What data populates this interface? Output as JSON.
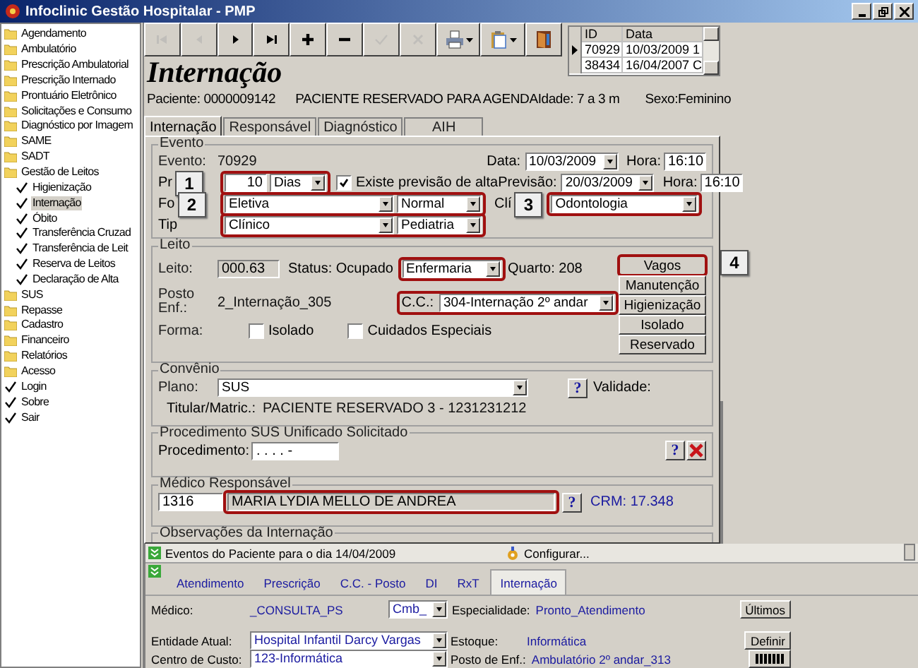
{
  "window": {
    "title": "Infoclinic Gestão Hospitalar - PMP"
  },
  "sidebar": {
    "items": [
      {
        "label": "Agendamento",
        "kind": "folder",
        "selected": false
      },
      {
        "label": "Ambulatório",
        "kind": "folder",
        "selected": false
      },
      {
        "label": "Prescrição Ambulatorial",
        "kind": "folder",
        "selected": false
      },
      {
        "label": "Prescrição Internado",
        "kind": "folder",
        "selected": false
      },
      {
        "label": "Prontuário Eletrônico",
        "kind": "folder",
        "selected": false
      },
      {
        "label": "Solicitações e Consumo",
        "kind": "folder",
        "selected": false
      },
      {
        "label": "Diagnóstico por Imagem",
        "kind": "folder",
        "selected": false
      },
      {
        "label": "SAME",
        "kind": "folder",
        "selected": false
      },
      {
        "label": "SADT",
        "kind": "folder",
        "selected": false
      },
      {
        "label": "Gestão de Leitos",
        "kind": "folder",
        "selected": false,
        "children": [
          {
            "label": "Higienização",
            "kind": "check",
            "selected": false
          },
          {
            "label": "Internação",
            "kind": "check",
            "selected": true
          },
          {
            "label": "Óbito",
            "kind": "check",
            "selected": false
          },
          {
            "label": "Transferência Cruzad",
            "kind": "check",
            "selected": false
          },
          {
            "label": "Transferência de Leit",
            "kind": "check",
            "selected": false
          },
          {
            "label": "Reserva de Leitos",
            "kind": "check",
            "selected": false
          },
          {
            "label": "Declaração de Alta",
            "kind": "check",
            "selected": false
          }
        ]
      },
      {
        "label": "SUS",
        "kind": "folder",
        "selected": false
      },
      {
        "label": "Repasse",
        "kind": "folder",
        "selected": false
      },
      {
        "label": "Cadastro",
        "kind": "folder",
        "selected": false
      },
      {
        "label": "Financeiro",
        "kind": "folder",
        "selected": false
      },
      {
        "label": "Relatórios",
        "kind": "folder",
        "selected": false
      },
      {
        "label": "Acesso",
        "kind": "folder",
        "selected": false
      },
      {
        "label": "Login",
        "kind": "check",
        "selected": false
      },
      {
        "label": "Sobre",
        "kind": "check",
        "selected": false
      },
      {
        "label": "Sair",
        "kind": "check",
        "selected": false
      }
    ]
  },
  "toolbar": {
    "buttons": [
      {
        "kind": "first",
        "disabled": true
      },
      {
        "kind": "prev",
        "disabled": true
      },
      {
        "kind": "next",
        "disabled": false
      },
      {
        "kind": "last",
        "disabled": false
      },
      {
        "kind": "add",
        "disabled": false
      },
      {
        "kind": "remove",
        "disabled": false
      },
      {
        "kind": "confirm",
        "disabled": true
      },
      {
        "kind": "cancel",
        "disabled": true
      },
      {
        "kind": "print",
        "disabled": false
      },
      {
        "kind": "paste",
        "disabled": false
      },
      {
        "kind": "exit",
        "disabled": false
      }
    ]
  },
  "record_grid": {
    "columns": [
      "ID",
      "Data"
    ],
    "rows": [
      {
        "id": "70929",
        "date": "10/03/2009 1",
        "selected": true
      },
      {
        "id": "38434",
        "date": "16/04/2007 C",
        "selected": false
      }
    ]
  },
  "page_title": "Internação",
  "patient": {
    "id": "Paciente: 0000009142",
    "name_age": "PACIENTE RESERVADO PARA AGENDAIdade: 7 a 3 m",
    "sex": "Sexo:Feminino"
  },
  "tabs": [
    {
      "label": "Internação",
      "selected": true
    },
    {
      "label": "Responsável",
      "selected": false
    },
    {
      "label": "Diagnóstico",
      "selected": false
    },
    {
      "label": "AIH",
      "selected": false
    }
  ],
  "evento": {
    "title": "Evento",
    "evento_label": "Evento:",
    "evento_value": "70929",
    "data_label": "Data:",
    "data_value": "10/03/2009",
    "hora_label": "Hora:",
    "hora_value": "16:10",
    "prazo_label": "Pr",
    "prazo_callout": "1",
    "prazo_value": "10",
    "prazo_unit": "Dias",
    "prazo_highlighted": true,
    "alta": {
      "label": "Existe previsão de alta",
      "checked": true
    },
    "previsao_label": "Previsão:",
    "previsao_value": "20/03/2009",
    "previsao_hora_label": "Hora:",
    "previsao_hora_value": "16:10",
    "forma_label": "Fo",
    "forma_callout": "2",
    "forma_values": [
      "Eletiva",
      "Normal"
    ],
    "forma_highlighted": true,
    "clinica_label": "Clí",
    "clinica_callout": "3",
    "clinica_value": "Odontologia",
    "clinica_highlighted": true,
    "tipo_label": "Tip",
    "tipo_values": [
      "Clínico",
      "Pediatria"
    ],
    "tipo_highlighted": true
  },
  "leito": {
    "title": "Leito",
    "leito_label": "Leito:",
    "leito_value": "000.63",
    "status": "Status: Ocupado",
    "acomodacao": "Enfermaria",
    "acomodacao_highlighted": true,
    "quarto": "Quarto: 208",
    "posto_label": "Posto Enf.:",
    "posto_value": "2_Internação_305",
    "cc_label": "C.C.:",
    "cc_value": "304-Internação 2º andar",
    "cc_highlighted": true,
    "forma_label": "Forma:",
    "checkboxes": [
      {
        "label": "Isolado",
        "checked": false
      },
      {
        "label": "Cuidados Especiais",
        "checked": false
      }
    ],
    "buttons": [
      {
        "label": "Vagos",
        "highlighted": true
      },
      {
        "label": "Manutenção",
        "highlighted": false
      },
      {
        "label": "Higienização",
        "highlighted": false
      },
      {
        "label": "Isolado",
        "highlighted": false
      },
      {
        "label": "Reservado",
        "highlighted": false
      }
    ],
    "callout": "4"
  },
  "convenio": {
    "title": "Convênio",
    "plano_label": "Plano:",
    "plano_value": "SUS",
    "help": "?",
    "validade_label": "Validade:",
    "titular_label": "Titular/Matric.:",
    "titular_value": "PACIENTE RESERVADO 3 - 1231231212"
  },
  "procedimento": {
    "title": "Procedimento SUS Unificado Solicitado",
    "label": "Procedimento:",
    "value": ". . . . -",
    "help": "?"
  },
  "medico": {
    "title": "Médico Responsável",
    "code": "1316",
    "name": "MARIA LYDIA MELLO DE ANDREA",
    "name_highlighted": true,
    "help": "?",
    "crm": "CRM: 17.348"
  },
  "observacoes": {
    "title": "Observações da Internação"
  },
  "bottom": {
    "events_title": "Eventos do Paciente para o dia 14/04/2009",
    "configure": "Configurar...",
    "tabs": [
      {
        "label": "Atendimento",
        "selected": false
      },
      {
        "label": "Prescrição",
        "selected": false
      },
      {
        "label": "C.C. - Posto",
        "selected": false
      },
      {
        "label": "DI",
        "selected": false
      },
      {
        "label": "RxT",
        "selected": false
      },
      {
        "label": "Internação",
        "selected": true
      }
    ],
    "medico_label": "Médico:",
    "medico_value": "_CONSULTA_PS",
    "cmb": "Cmb_",
    "especialidade_label": "Especialidade:",
    "especialidade_value": "Pronto_Atendimento",
    "ultimos": "Últimos",
    "entidade_label": "Entidade Atual:",
    "entidade_value": "Hospital Infantil Darcy Vargas",
    "estoque_label": "Estoque:",
    "estoque_value": "Informática",
    "definir": "Definir",
    "centro_label": "Centro de Custo:",
    "centro_value": "123-Informática",
    "posto_label": "Posto de Enf.:",
    "posto_value": "Ambulatório 2º andar_313"
  }
}
